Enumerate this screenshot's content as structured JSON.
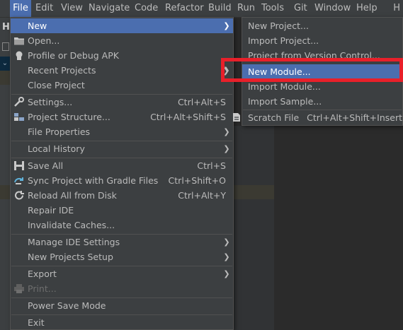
{
  "menubar": {
    "items": [
      "File",
      "Edit",
      "View",
      "Navigate",
      "Code",
      "Refactor",
      "Build",
      "Run",
      "Tools",
      "Git",
      "Window",
      "Help"
    ],
    "right_glyph": "H"
  },
  "background": {
    "left_panel_letter": "H"
  },
  "file_menu": {
    "items": [
      {
        "label": "New",
        "shortcut": "",
        "submenu": true,
        "icon": "none"
      },
      {
        "label": "Open...",
        "shortcut": "",
        "submenu": false,
        "icon": "folder-icon"
      },
      {
        "label": "Profile or Debug APK",
        "shortcut": "",
        "submenu": false,
        "icon": "apk-icon"
      },
      {
        "label": "Recent Projects",
        "shortcut": "",
        "submenu": true,
        "icon": "none"
      },
      {
        "label": "Close Project",
        "shortcut": "",
        "submenu": false,
        "icon": "none"
      },
      {
        "label": "Settings...",
        "shortcut": "Ctrl+Alt+S",
        "submenu": false,
        "icon": "wrench-icon"
      },
      {
        "label": "Project Structure...",
        "shortcut": "Ctrl+Alt+Shift+S",
        "submenu": false,
        "icon": "project-structure-icon"
      },
      {
        "label": "File Properties",
        "shortcut": "",
        "submenu": true,
        "icon": "none"
      },
      {
        "label": "Local History",
        "shortcut": "",
        "submenu": true,
        "icon": "none"
      },
      {
        "label": "Save All",
        "shortcut": "Ctrl+S",
        "submenu": false,
        "icon": "save-icon"
      },
      {
        "label": "Sync Project with Gradle Files",
        "shortcut": "Ctrl+Shift+O",
        "submenu": false,
        "icon": "gradle-sync-icon"
      },
      {
        "label": "Reload All from Disk",
        "shortcut": "Ctrl+Alt+Y",
        "submenu": false,
        "icon": "reload-icon"
      },
      {
        "label": "Repair IDE",
        "shortcut": "",
        "submenu": false,
        "icon": "none"
      },
      {
        "label": "Invalidate Caches...",
        "shortcut": "",
        "submenu": false,
        "icon": "none"
      },
      {
        "label": "Manage IDE Settings",
        "shortcut": "",
        "submenu": true,
        "icon": "none"
      },
      {
        "label": "New Projects Setup",
        "shortcut": "",
        "submenu": true,
        "icon": "none"
      },
      {
        "label": "Export",
        "shortcut": "",
        "submenu": true,
        "icon": "none"
      },
      {
        "label": "Print...",
        "shortcut": "",
        "submenu": false,
        "icon": "print-icon",
        "disabled": true
      },
      {
        "label": "Power Save Mode",
        "shortcut": "",
        "submenu": false,
        "icon": "none"
      },
      {
        "label": "Exit",
        "shortcut": "",
        "submenu": false,
        "icon": "none"
      }
    ]
  },
  "new_submenu": {
    "items": [
      {
        "label": "New Project...",
        "shortcut": ""
      },
      {
        "label": "Import Project...",
        "shortcut": ""
      },
      {
        "label": "Project from Version Control...",
        "shortcut": ""
      },
      {
        "label": "New Module...",
        "shortcut": "",
        "highlighted": true
      },
      {
        "label": "Import Module...",
        "shortcut": ""
      },
      {
        "label": "Import Sample...",
        "shortcut": ""
      },
      {
        "label": "Scratch File",
        "shortcut": "Ctrl+Alt+Shift+Insert",
        "icon": "scratch-file-icon"
      }
    ]
  },
  "arrow_glyph": "❯",
  "colors": {
    "accent": "#4b6eaf",
    "annotation_box": "#e8202a",
    "menu_bg": "#3c3f41"
  }
}
